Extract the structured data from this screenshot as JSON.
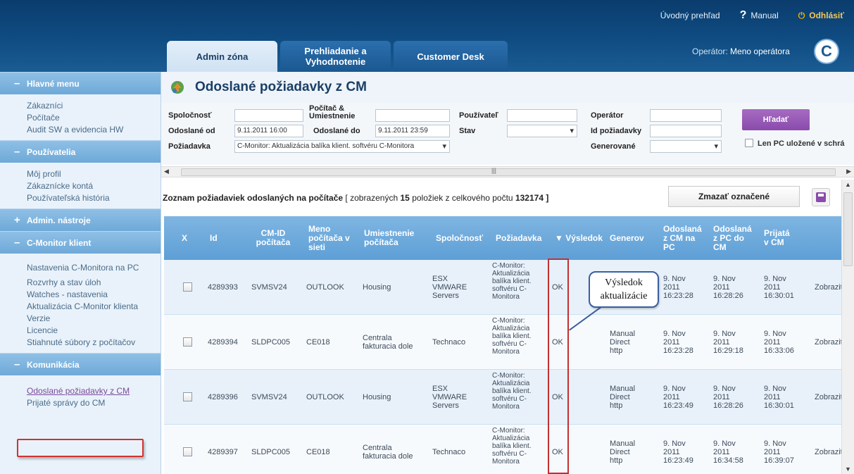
{
  "header": {
    "links": {
      "overview": "Úvodný prehľad",
      "manual": "Manual",
      "logout": "Odhlásiť"
    },
    "tabs": {
      "admin": "Admin zóna",
      "prehliadanie_l1": "Prehliadanie a",
      "prehliadanie_l2": "Vyhodnotenie",
      "customer": "Customer Desk"
    },
    "operator_label": "Operátor:",
    "operator_name": "Meno operátora",
    "logo": "C"
  },
  "sidebar": {
    "sections": [
      {
        "sign": "–",
        "title": "Hlavné menu",
        "items": [
          "Zákazníci",
          "Počítače",
          "Audit SW a evidencia HW"
        ]
      },
      {
        "sign": "–",
        "title": "Používatelia",
        "items": [
          "Môj profil",
          "Zákaznícke kontá",
          "Používateľská história"
        ]
      },
      {
        "sign": "+",
        "title": "Admin. nástroje",
        "items": []
      },
      {
        "sign": "–",
        "title": "C-Monitor klient",
        "items": [
          "Nastavenia C-Monitora na PC",
          "Rozvrhy a stav úloh",
          "Watches - nastavenia",
          "Aktualizácia C-Monitor klienta",
          "Verzie",
          "Licencie",
          "Stiahnuté súbory z počítačov"
        ]
      },
      {
        "sign": "–",
        "title": "Komunikácia",
        "items": [
          "Odoslané požiadavky z CM",
          "Prijaté správy do CM"
        ]
      }
    ]
  },
  "page": {
    "title": "Odoslané požiadavky z CM"
  },
  "filters": {
    "company_label": "Spoločnosť",
    "computer_label_l1": "Počítač &",
    "computer_label_l2": "Umiestnenie",
    "user_label": "Používateľ",
    "operator_label": "Operátor",
    "sent_from_label": "Odoslané od",
    "sent_from_value": "9.11.2011 16:00",
    "sent_to_label": "Odoslané do",
    "sent_to_value": "9.11.2011 23:59",
    "state_label": "Stav",
    "request_id_label": "Id požiadavky",
    "request_label": "Požiadavka",
    "request_value": "C-Monitor: Aktualizácia balíka klient. softvéru C-Monitora",
    "generated_label": "Generované",
    "search_button": "Hľadať",
    "only_saved_label": "Len PC uložené v schrá"
  },
  "list": {
    "header_bold": "Zoznam požiadaviek odoslaných na počítače",
    "header_pre": "[ zobrazených",
    "shown": "15",
    "header_mid": "položiek z celkového počtu",
    "total": "132174",
    "header_post": "]",
    "delete_button": "Zmazať označené"
  },
  "table": {
    "columns": {
      "x": "X",
      "id": "Id",
      "cmid_l1": "CM-ID",
      "cmid_l2": "počítača",
      "name_l1": "Meno",
      "name_l2": "počítača v",
      "name_l3": "sieti",
      "loc_l1": "Umiestnenie",
      "loc_l2": "počítača",
      "company": "Spoločnosť",
      "request": "Požiadavka",
      "result": "▼ Výsledok",
      "generated": "Generov",
      "sent_cm_l1": "Odoslaná",
      "sent_cm_l2": "z CM na",
      "sent_cm_l3": "PC",
      "sent_pc_l1": "Odoslaná",
      "sent_pc_l2": "z PC do",
      "sent_pc_l3": "CM",
      "recv_l1": "Prijatá",
      "recv_l2": "v CM"
    },
    "rows": [
      {
        "id": "4289393",
        "cmid": "SVMSV24",
        "name": "OUTLOOK",
        "loc1": "Housing",
        "loc2": "",
        "comp1": "ESX",
        "comp2": "VMWARE",
        "comp3": "Servers",
        "req1": "C-Monitor:",
        "req2": "Aktualizácia",
        "req3": "balíka klient.",
        "req4": "softvéru C-",
        "req5": "Monitora",
        "result": "OK",
        "gen1": "",
        "gen2": "",
        "gen3": "",
        "s1a": "9. Nov",
        "s1b": "2011",
        "s1c": "16:23:28",
        "s2a": "9. Nov",
        "s2b": "2011",
        "s2c": "16:28:26",
        "s3a": "9. Nov",
        "s3b": "2011",
        "s3c": "16:30:01",
        "action": "Zobraziť"
      },
      {
        "id": "4289394",
        "cmid": "SLDPC005",
        "name": "CE018",
        "loc1": "Centrala",
        "loc2": "fakturacia dole",
        "comp1": "",
        "comp2": "Technaco",
        "comp3": "",
        "req1": "C-Monitor:",
        "req2": "Aktualizácia",
        "req3": "balíka klient.",
        "req4": "softvéru C-",
        "req5": "Monitora",
        "result": "OK",
        "gen1": "Manual",
        "gen2": "Direct",
        "gen3": "http",
        "s1a": "9. Nov",
        "s1b": "2011",
        "s1c": "16:23:28",
        "s2a": "9. Nov",
        "s2b": "2011",
        "s2c": "16:29:18",
        "s3a": "9. Nov",
        "s3b": "2011",
        "s3c": "16:33:06",
        "action": "Zobraziť"
      },
      {
        "id": "4289396",
        "cmid": "SVMSV24",
        "name": "OUTLOOK",
        "loc1": "Housing",
        "loc2": "",
        "comp1": "ESX",
        "comp2": "VMWARE",
        "comp3": "Servers",
        "req1": "C-Monitor:",
        "req2": "Aktualizácia",
        "req3": "balíka klient.",
        "req4": "softvéru C-",
        "req5": "Monitora",
        "result": "OK",
        "gen1": "Manual",
        "gen2": "Direct",
        "gen3": "http",
        "s1a": "9. Nov",
        "s1b": "2011",
        "s1c": "16:23:49",
        "s2a": "9. Nov",
        "s2b": "2011",
        "s2c": "16:28:26",
        "s3a": "9. Nov",
        "s3b": "2011",
        "s3c": "16:30:01",
        "action": "Zobraziť"
      },
      {
        "id": "4289397",
        "cmid": "SLDPC005",
        "name": "CE018",
        "loc1": "Centrala",
        "loc2": "fakturacia dole",
        "comp1": "",
        "comp2": "Technaco",
        "comp3": "",
        "req1": "C-Monitor:",
        "req2": "Aktualizácia",
        "req3": "balíka klient.",
        "req4": "softvéru C-",
        "req5": "Monitora",
        "result": "OK",
        "gen1": "Manual",
        "gen2": "Direct",
        "gen3": "http",
        "s1a": "9. Nov",
        "s1b": "2011",
        "s1c": "16:23:49",
        "s2a": "9. Nov",
        "s2b": "2011",
        "s2c": "16:34:58",
        "s3a": "9. Nov",
        "s3b": "2011",
        "s3c": "16:39:07",
        "action": "Zobraziť"
      }
    ]
  },
  "callout": {
    "line1": "Výsledok",
    "line2": "aktualizácie"
  },
  "colors": {
    "header": "#0f4c82",
    "sidebar_section": "#7fb4de",
    "table_header": "#6aa7dc",
    "accent_purple": "#8a4bac",
    "highlight_red": "#c23030"
  }
}
